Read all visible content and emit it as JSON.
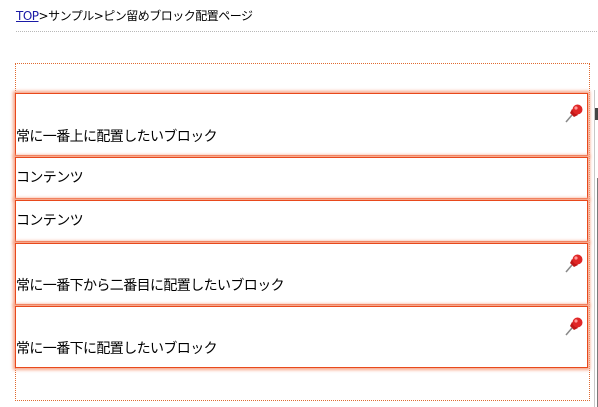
{
  "breadcrumb": {
    "home_link": "TOP",
    "separator": ">",
    "sample": "サンプル",
    "current": "ピン留めブロック配置ページ"
  },
  "blocks": [
    {
      "text": "常に一番上に配置したいブロック",
      "pinned": true
    },
    {
      "text": "コンテンツ",
      "pinned": false
    },
    {
      "text": "コンテンツ",
      "pinned": false
    },
    {
      "text": "常に一番下から二番目に配置したいブロック",
      "pinned": true
    },
    {
      "text": "常に一番下に配置したいブロック",
      "pinned": true
    }
  ],
  "colors": {
    "block_border": "#e8491c",
    "block_glow": "#f7a68a",
    "link": "#1a1aa6",
    "pin": "#d82020"
  },
  "icons": {
    "pin": "pushpin-icon"
  }
}
